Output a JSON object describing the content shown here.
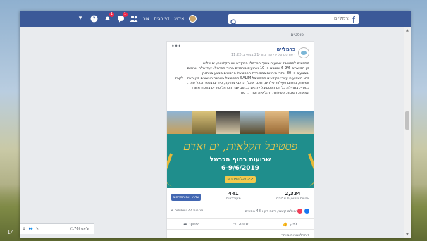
{
  "desktop": {
    "corner_number": "14"
  },
  "topbar": {
    "logo": "f",
    "search_placeholder": "כרמליים",
    "nav_user": "אירוע",
    "nav_home": "דף הבית",
    "nav_create": "צור",
    "messages_badge": "1",
    "notifications_badge": "1",
    "icons": [
      "search-icon",
      "friends-icon",
      "messenger-icon",
      "notifications-icon",
      "help-icon",
      "dropdown-icon"
    ]
  },
  "feed": {
    "section_title": "פוסטים"
  },
  "post": {
    "page_name": "כרמליים",
    "meta": "פורסם על ידי אור גזון ·21 במאי ב-11:22 ·",
    "text": [
      "מתכונים לפסטיבל שבועות בחוף הכרמל: המקדש והו הקלאות, ים שלוש",
      "בין המוצרים 6-9/6 וחוגגים כ- 10 אירועים מרכזיים בחוף הכרמל. יועד שלה ארוכים",
      "ומבצעים כ- 80 אתרי חירויות במבוררת הפסטיבל הרמאים ממגע באתגרן",
      "בחג השבועות עשרי חקלאים הפסטיבל SALIM הפסטיבל באתגר ראשונים ביין השל - לקבל",
      "אפשות, מתחם פעילות לילדים, דוכני אוכל, הרכבי מוזיקה, סיורים בכפר ובכל אתר.",
      "בנוסף, בתחילת כל יום הפסטיבל יתקיים בכתוב יוצר הכרמל סיורים בשטח משרד",
      "ונמאות, תמכות, פעילויות חקלאיות ועוד ... עוד"
    ],
    "banner": {
      "title": "פסטיבל חקלאות, ים ואדם",
      "subtitle": "שבועות בחוף הכרמל",
      "date": "6-9/6/2019",
      "button": "לכל האתרים >>"
    },
    "stats": {
      "reach": "2,334",
      "reach_label": "אנשים שהוגעת אליהם",
      "engagement": "441",
      "engagement_label": "מעורבויות",
      "boost_button": "שדרג את הפרסום"
    },
    "reactions": {
      "summary": "ניהולים קשמי, רינה דגן ו-48 נוספים",
      "counts": "4 תגובות 22 שיתופים"
    },
    "actions": {
      "like": "לייק",
      "comment": "תגובה",
      "share": "שיתוף"
    },
    "comments_sort": "הרלוונטיות ביותר ▾"
  },
  "chat": {
    "label": "צ'אט (176)"
  },
  "colors": {
    "facebook_blue": "#3b5998",
    "banner_teal": "#1f8e8c",
    "banner_gold": "#f2c94c"
  }
}
